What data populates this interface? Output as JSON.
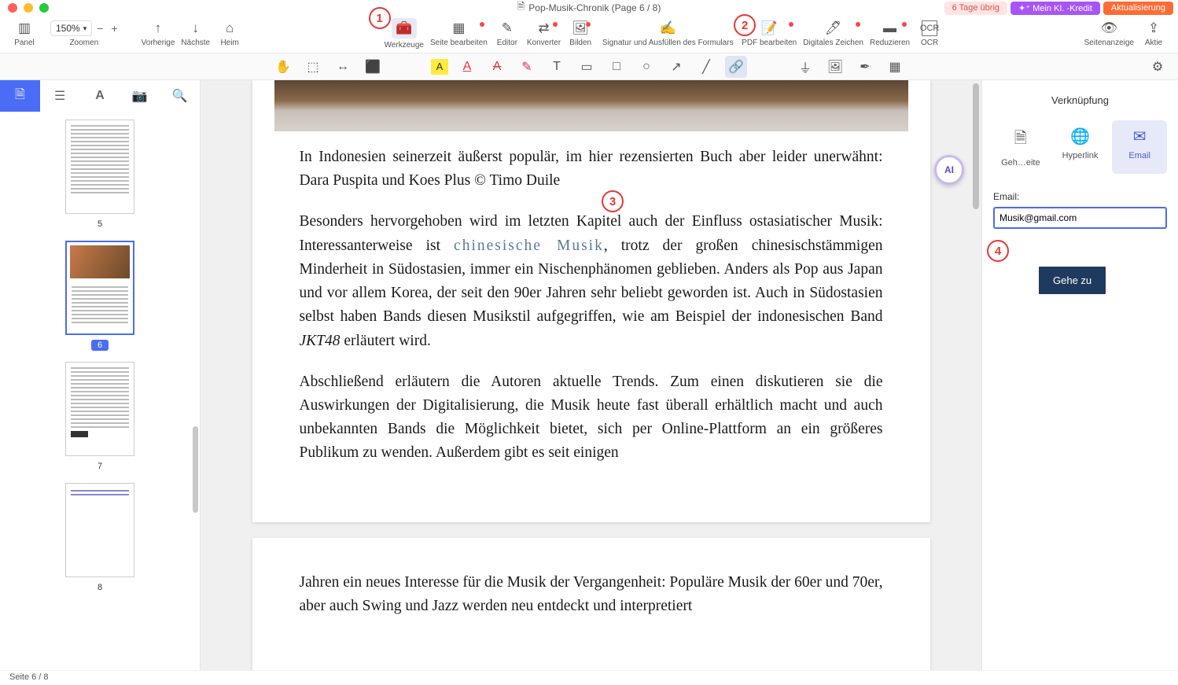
{
  "window": {
    "title": "Pop-Musik-Chronik (Page 6 / 8)",
    "badges": {
      "trial": "6 Tage übrig",
      "ai": "✦⁺ Mein KI. -Kredit",
      "update": "Aktualisierung"
    }
  },
  "toolbar": {
    "panel": "Panel",
    "zoom_value": "150%",
    "zoom_label": "Zoomen",
    "prev": "Vorherige",
    "next": "Nächste",
    "home": "Heim",
    "tools": "Werkzeuge",
    "page_edit": "Seite bearbeiten",
    "editor": "Editor",
    "converter": "Konverter",
    "images": "Bilden",
    "sign_fill": "Signatur und Ausfüllen des Formulars",
    "pdf_edit": "PDF bearbeiten",
    "digital_sign": "Digitales Zeichen",
    "redact": "Reduzieren",
    "ocr": "OCR",
    "page_display": "Seitenanzeige",
    "share": "Aktie"
  },
  "callouts": {
    "c1": "1",
    "c2": "2",
    "c3": "3",
    "c4": "4"
  },
  "thumbnails": {
    "pg5": "5",
    "pg6": "6",
    "pg7": "7",
    "pg8": "8"
  },
  "doc": {
    "caption": "In Indonesien seinerzeit äußerst populär, im hier rezensierten Buch aber leider unerwähnt: Dara Puspita und Koes Plus © Timo Duile",
    "para2a": "Besonders hervorgehoben wird im letzten Kapitel auch der Einfluss ostasiatischer Musik: Interessanterweise ist ",
    "para2link": "chinesische Musik",
    "para2b": ", trotz der großen chinesischstämmigen Minderheit in Südostasien, immer ein Nischenphänomen geblieben. Anders als Pop aus Japan und vor allem Korea, der seit den 90er Jahren sehr beliebt geworden ist. Auch in Südostasien selbst haben Bands diesen Musikstil aufgegriffen, wie am Beispiel der indonesischen Band ",
    "para2ital": "JKT48",
    "para2c": " erläutert wird.",
    "para3": "Abschließend erläutern die Autoren aktuelle Trends. Zum einen diskutieren sie die Auswirkungen der Digitalisierung, die Musik heute fast überall erhältlich macht und auch unbekannten Bands die Möglichkeit bietet, sich per Online-Plattform an ein größeres Publikum zu wenden. Außerdem gibt es seit einigen",
    "page2_para": "Jahren ein neues Interesse für die Musik der Vergangenheit: Populäre Musik der 60er und 70er, aber auch Swing und Jazz werden neu entdeckt und interpretiert"
  },
  "right_panel": {
    "title": "Verknüpfung",
    "tab_page": "Geh…eite",
    "tab_hyperlink": "Hyperlink",
    "tab_email": "Email",
    "email_label": "Email:",
    "email_value": "Musik@gmail.com",
    "go_button": "Gehe zu"
  },
  "status": "Seite 6 / 8",
  "ai_float": "AI"
}
